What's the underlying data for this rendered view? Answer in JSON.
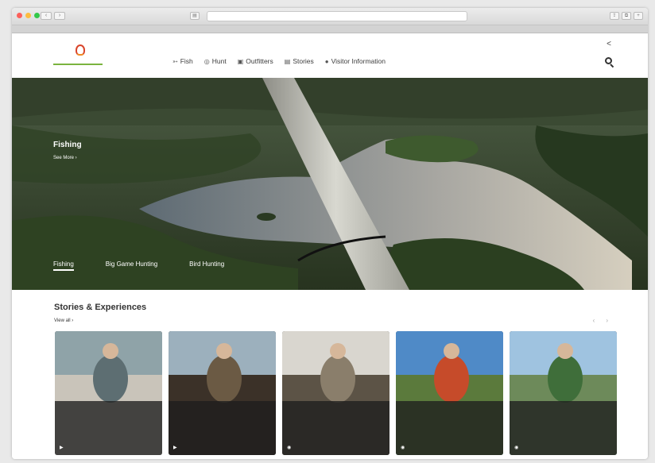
{
  "browser": {
    "url": "",
    "tab_label": ""
  },
  "header": {
    "logo_top": "",
    "logo_main": "",
    "logo_sub": "",
    "nav": [
      {
        "icon": "fish-icon",
        "glyph": "➳",
        "label": "Fish"
      },
      {
        "icon": "hunt-icon",
        "glyph": "◎",
        "label": "Hunt"
      },
      {
        "icon": "outfitters-icon",
        "glyph": "▣",
        "label": "Outfitters"
      },
      {
        "icon": "stories-icon",
        "glyph": "▤",
        "label": "Stories"
      },
      {
        "icon": "info-icon",
        "glyph": "●",
        "label": "Visitor Information"
      }
    ]
  },
  "hero": {
    "title": "Fishing",
    "description": "",
    "more_label": "See More ›",
    "tabs": [
      "Fishing",
      "Big Game Hunting",
      "Bird Hunting"
    ]
  },
  "stories": {
    "title": "Stories & Experiences",
    "view_all": "View all ›",
    "prev": "‹",
    "next": "›",
    "cards": [
      {
        "title": "",
        "desc": ""
      },
      {
        "title": "",
        "desc": ""
      },
      {
        "title": "",
        "desc": ""
      },
      {
        "title": "",
        "desc": ""
      },
      {
        "title": "",
        "desc": ""
      }
    ]
  },
  "colors": {
    "accent_green": "#2a8a5e",
    "logo_red": "#d9452b",
    "logo_orange": "#f08a24",
    "card_overlay": "#1e1e1e"
  }
}
